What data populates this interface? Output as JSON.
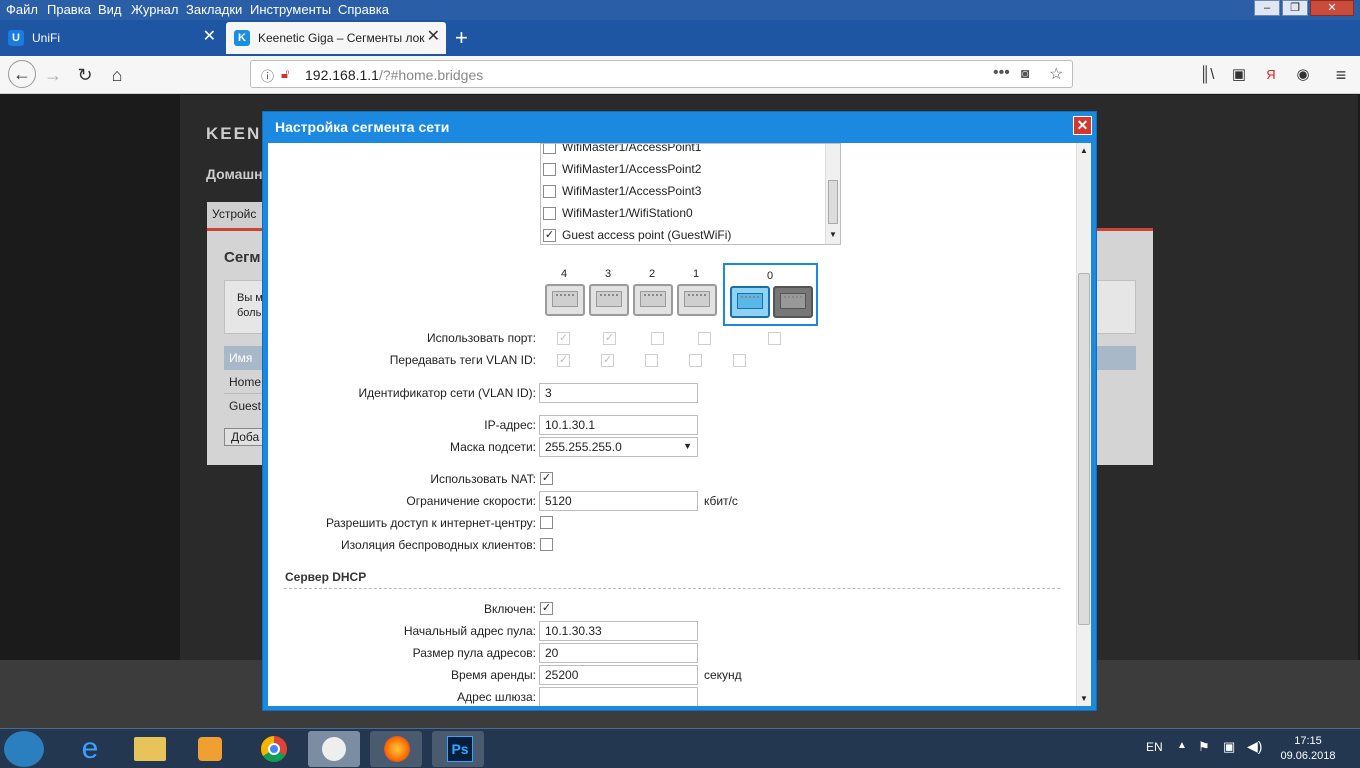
{
  "menu": [
    "Файл",
    "Правка",
    "Вид",
    "Журнал",
    "Закладки",
    "Инструменты",
    "Справка"
  ],
  "tabs": [
    {
      "label": "UniFi",
      "favicon": "U"
    },
    {
      "label": "Keenetic Giga – Сегменты лок",
      "favicon": "K"
    }
  ],
  "new_tab_label": "+",
  "url": {
    "host": "192.168.1.1",
    "path": "/?#home.bridges"
  },
  "page_behind": {
    "brand": "KEEN",
    "subtitle": "Домашн",
    "tab": "Устройс",
    "section": "Сегм",
    "info_lines": [
      "Вы м",
      "боль"
    ],
    "table_header": "Имя",
    "rows": [
      "Home",
      "Guest"
    ],
    "add_button": "Доба"
  },
  "dialog": {
    "title": "Настройка сегмента сети",
    "interfaces": [
      {
        "label": "WifiMaster1/AccessPoint1",
        "checked": false
      },
      {
        "label": "WifiMaster1/AccessPoint2",
        "checked": false
      },
      {
        "label": "WifiMaster1/AccessPoint3",
        "checked": false
      },
      {
        "label": "WifiMaster1/WifiStation0",
        "checked": false
      },
      {
        "label": "Guest access point (GuestWiFi)",
        "checked": true
      }
    ],
    "ports": [
      "4",
      "3",
      "2",
      "1",
      "0"
    ],
    "use_port_label": "Использовать порт:",
    "use_port": [
      true,
      true,
      false,
      false,
      false
    ],
    "vlan_tags_label": "Передавать теги VLAN ID:",
    "vlan_tags": [
      true,
      true,
      false,
      false,
      false
    ],
    "vlan_id_label": "Идентификатор сети (VLAN ID):",
    "vlan_id": "3",
    "ip_label": "IP-адрес:",
    "ip": "10.1.30.1",
    "mask_label": "Маска подсети:",
    "mask": "255.255.255.0",
    "nat_label": "Использовать NAT:",
    "nat": true,
    "speed_label": "Ограничение скорости:",
    "speed": "5120",
    "speed_unit": "кбит/с",
    "access_label": "Разрешить доступ к интернет-центру:",
    "access": false,
    "isolation_label": "Изоляция беспроводных клиентов:",
    "isolation": false,
    "dhcp_header": "Сервер DHCP",
    "dhcp_enabled_label": "Включен:",
    "dhcp_enabled": true,
    "pool_start_label": "Начальный адрес пула:",
    "pool_start": "10.1.30.33",
    "pool_size_label": "Размер пула адресов:",
    "pool_size": "20",
    "lease_label": "Время аренды:",
    "lease": "25200",
    "lease_unit": "секунд",
    "gateway_label": "Адрес шлюза:",
    "gateway": ""
  },
  "tray": {
    "lang": "EN",
    "time": "17:15",
    "date": "09.06.2018"
  },
  "colors": {
    "browser_chrome": "#1f56a4",
    "dialog_blue": "#1b89e0",
    "close_red": "#d2382d",
    "port_active": "#1b89e0"
  }
}
